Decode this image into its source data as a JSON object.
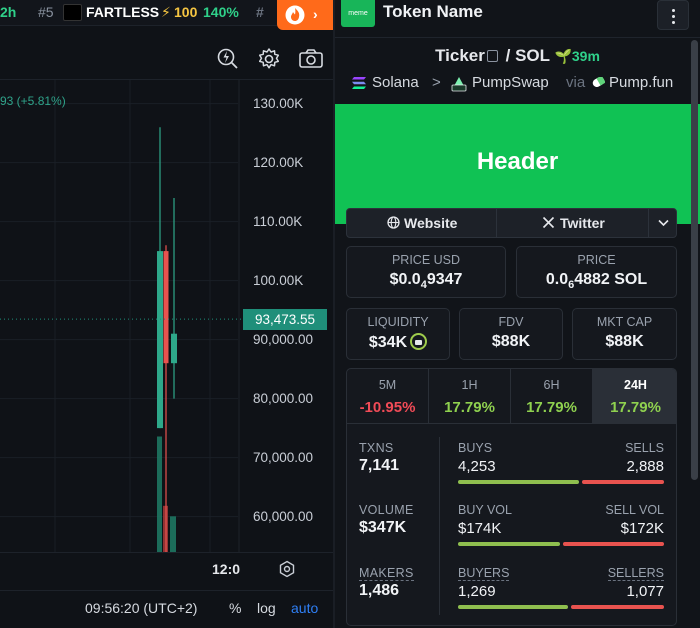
{
  "ticker_bar": {
    "timeframe_fragment": "2h",
    "rank": "#5",
    "token": "FARTLESS",
    "count": "100",
    "percent": "140%",
    "next_rank_fragment": "#"
  },
  "toolbar": {
    "tools": [
      "lightning-search-icon",
      "gear-icon",
      "camera-icon"
    ]
  },
  "chart": {
    "change_label": "93 (+5.81%)",
    "current_price": "93,473.55",
    "time_label": "12:0",
    "colors": {
      "up": "#2ea88a",
      "down": "#e8534f",
      "price_tag": "#1f8f7a"
    }
  },
  "chart_data": {
    "type": "candlestick",
    "y_tick_labels": [
      "130.00K",
      "120.00K",
      "110.00K",
      "100.00K",
      "90,000.00",
      "80,000.00",
      "70,000.00",
      "60,000.00"
    ],
    "ylim": [
      54000,
      134000
    ],
    "current_price": 93473.55,
    "candles": [
      {
        "open": 75000,
        "high": 126000,
        "low": 75000,
        "close": 105000,
        "direction": "up"
      },
      {
        "open": 105000,
        "high": 106000,
        "low": 48000,
        "close": 86000,
        "direction": "down"
      },
      {
        "open": 86000,
        "high": 114000,
        "low": 80000,
        "close": 91000,
        "direction": "up"
      }
    ],
    "volume": [
      {
        "value": 0.55,
        "direction": "up"
      },
      {
        "value": 0.22,
        "direction": "down"
      },
      {
        "value": 0.17,
        "direction": "up"
      }
    ]
  },
  "status_bar": {
    "time": "09:56:20 (UTC+2)",
    "percent": "%",
    "log": "log",
    "auto": "auto"
  },
  "panel": {
    "logo_text": "meme",
    "token_name": "Token Name",
    "ticker": "Ticker",
    "slash": "/",
    "quote": "SOL",
    "age": "39m",
    "chain": "Solana",
    "chevron": ">",
    "dex": "PumpSwap",
    "via": "via",
    "launchpad": "Pump.fun",
    "banner_text": "Header",
    "links": {
      "website": "Website",
      "twitter": "Twitter"
    },
    "stats": {
      "price_usd_label": "PRICE USD",
      "price_usd_main": "$0.0",
      "price_usd_sub": "4",
      "price_usd_tail": "9347",
      "price_label": "PRICE",
      "price_main": "0.0",
      "price_sub": "6",
      "price_tail": "4882 SOL",
      "liquidity_label": "LIQUIDITY",
      "liquidity": "$34K",
      "fdv_label": "FDV",
      "fdv": "$88K",
      "mktcap_label": "MKT CAP",
      "mktcap": "$88K"
    },
    "timeframes": [
      {
        "label": "5M",
        "value": "-10.95%",
        "sign": "neg"
      },
      {
        "label": "1H",
        "value": "17.79%",
        "sign": "pos"
      },
      {
        "label": "6H",
        "value": "17.79%",
        "sign": "pos"
      },
      {
        "label": "24H",
        "value": "17.79%",
        "sign": "pos",
        "active": true
      }
    ],
    "metrics": {
      "txns_label": "TXNS",
      "txns": "7,141",
      "volume_label": "VOLUME",
      "volume": "$347K",
      "makers_label": "MAKERS",
      "makers": "1,486",
      "buys_label": "BUYS",
      "buys": "4,253",
      "sells_label": "SELLS",
      "sells": "2,888",
      "buy_vol_label": "BUY VOL",
      "buy_vol": "$174K",
      "sell_vol_label": "SELL VOL",
      "sell_vol": "$172K",
      "buyers_label": "BUYERS",
      "buyers": "1,269",
      "sellers_label": "SELLERS",
      "sellers": "1,077"
    },
    "ratios": {
      "buys": 0.596,
      "buy_vol": 0.503,
      "buyers": 0.541
    }
  }
}
